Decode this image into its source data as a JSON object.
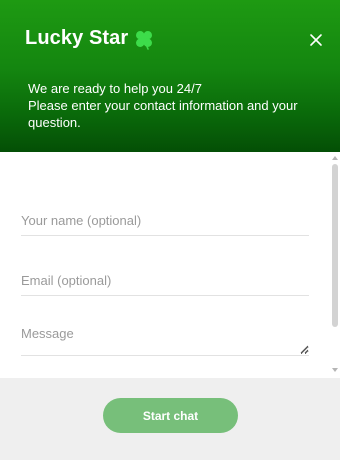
{
  "header": {
    "title": "Lucky Star",
    "title_icon": "clover-icon",
    "close_icon": "close-icon",
    "intro_lines": [
      "We are ready to help you 24/7",
      "Please enter your contact information and your question."
    ],
    "gradient": [
      "#1e9a12",
      "#044f06"
    ]
  },
  "form": {
    "name_placeholder": "Your name (optional)",
    "email_placeholder": "Email (optional)",
    "message_placeholder": "Message",
    "name_value": "",
    "email_value": "",
    "message_value": ""
  },
  "footer": {
    "start_label": "Start chat",
    "button_color": "#77bf7a"
  },
  "colors": {
    "brand_green": "#148610",
    "clover_green": "#3ddc4a"
  }
}
